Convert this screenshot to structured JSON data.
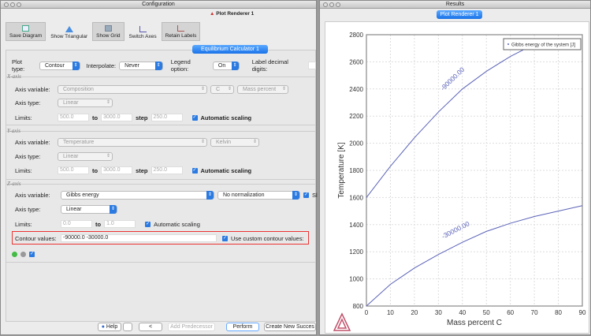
{
  "config": {
    "title": "Configuration",
    "renderer_tab": "Plot Renderer 1",
    "toolbar": [
      {
        "label": "Save Diagram",
        "icon": "save-diagram-icon",
        "active": true
      },
      {
        "label": "Show Triangular",
        "icon": "triangle-icon",
        "active": false
      },
      {
        "label": "Show Grid",
        "icon": "grid-icon",
        "active": true
      },
      {
        "label": "Switch Axes",
        "icon": "switch-axes-icon",
        "active": false
      },
      {
        "label": "Retain Labels",
        "icon": "retain-labels-icon",
        "active": true
      }
    ],
    "calc_tab": "Equilibrium Calculator 1",
    "plot_type_label": "Plot type:",
    "plot_type": "Contour",
    "interpolate_label": "Interpolate:",
    "interpolate": "Never",
    "legend_label": "Legend option:",
    "legend": "On",
    "decimal_label": "Label decimal digits:",
    "xaxis": {
      "title": "X-axis",
      "var_label": "Axis variable:",
      "var": "Composition",
      "comp": "C",
      "unit": "Mass percent",
      "type_label": "Axis type:",
      "type": "Linear",
      "limits_label": "Limits:",
      "from": "500.0",
      "to_label": "to",
      "to": "3000.0",
      "step_label": "step",
      "step": "250.0",
      "auto": "Automatic scaling"
    },
    "yaxis": {
      "title": "Y-axis",
      "var_label": "Axis variable:",
      "var": "Temperature",
      "unit": "Kelvin",
      "type_label": "Axis type:",
      "type": "Linear",
      "limits_label": "Limits:",
      "from": "500.0",
      "to_label": "to",
      "to": "3000.0",
      "step_label": "step",
      "step": "250.0",
      "auto": "Automatic scaling"
    },
    "zaxis": {
      "title": "Z-axis",
      "var_label": "Axis variable:",
      "var": "Gibbs energy",
      "norm": "No normalization",
      "extra": "Sl",
      "type_label": "Axis type:",
      "type": "Linear",
      "limits_label": "Limits:",
      "from": "0.0",
      "to_label": "to",
      "to": "1.0",
      "auto": "Automatic scaling",
      "contour_label": "Contour values:",
      "contour": "-90000.0 -30000.0",
      "custom": "Use custom contour values:"
    },
    "buttons": {
      "help": "Help",
      "back": "<",
      "add_pred": "Add Predecessor",
      "perform": "Perform",
      "create": "Create New Succes"
    }
  },
  "results": {
    "title": "Results",
    "tab": "Plot Renderer 1"
  },
  "chart_data": {
    "type": "line",
    "xlabel": "Mass percent C",
    "ylabel": "Temperature [K]",
    "xlim": [
      0,
      90
    ],
    "ylim": [
      800,
      2800
    ],
    "grid": true,
    "legend": "top-right",
    "legend_entries": [
      "Gibbs energy of the system [J]"
    ],
    "xticks": [
      "0",
      "10",
      "20",
      "30",
      "40",
      "50",
      "60",
      "70",
      "80",
      "90"
    ],
    "yticks": [
      "800",
      "1000",
      "1200",
      "1400",
      "1600",
      "1800",
      "2000",
      "2200",
      "2400",
      "2600",
      "2800"
    ],
    "series": [
      {
        "contour_label": "-90000.00",
        "x": [
          0,
          10,
          20,
          30,
          40,
          50,
          60,
          70
        ],
        "y": [
          1600,
          1830,
          2040,
          2230,
          2400,
          2530,
          2640,
          2730
        ]
      },
      {
        "contour_label": "-30000.00",
        "x": [
          0,
          10,
          20,
          30,
          40,
          50,
          60,
          70,
          80,
          90
        ],
        "y": [
          800,
          960,
          1080,
          1180,
          1270,
          1350,
          1410,
          1460,
          1500,
          1540
        ]
      }
    ],
    "line_color": "#5b63b8"
  }
}
